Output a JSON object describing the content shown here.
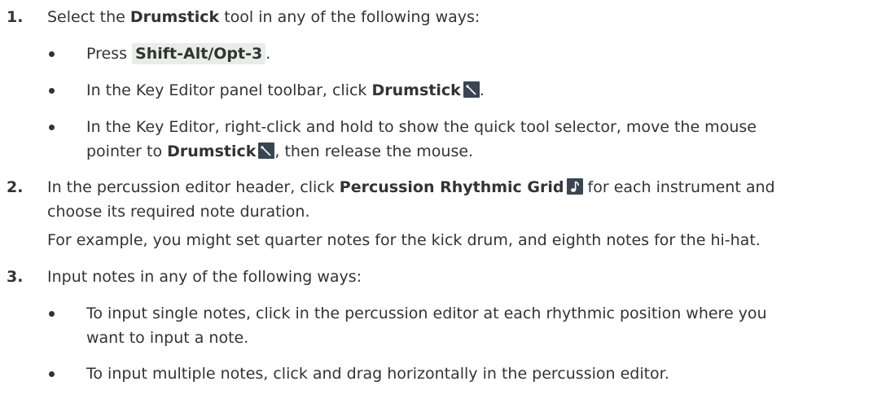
{
  "steps": [
    {
      "number": "1.",
      "intro": {
        "pre": "Select the ",
        "bold": "Drumstick",
        "post": " tool in any of the following ways:"
      },
      "bullets": {
        "b1": {
          "pre": "Press ",
          "shortcut": "Shift-Alt/Opt-3",
          "post": "."
        },
        "b2": {
          "pre": "In the Key Editor panel toolbar, click ",
          "bold": "Drumstick",
          "post": "."
        },
        "b3": {
          "line1": "In the Key Editor, right-click and hold to show the quick tool selector, move the mouse",
          "pre": "pointer to ",
          "bold": "Drumstick",
          "post": ", then release the mouse."
        }
      }
    },
    {
      "number": "2.",
      "pre": "In the percussion editor header, click ",
      "bold": "Percussion Rhythmic Grid",
      "post": " for each instrument and",
      "line2": "choose its required note duration.",
      "example": "For example, you might set quarter notes for the kick drum, and eighth notes for the hi-hat."
    },
    {
      "number": "3.",
      "intro": "Input notes in any of the following ways:",
      "bullets": {
        "b1": {
          "line1": "To input single notes, click in the percussion editor at each rhythmic position where you",
          "line2": "want to input a note."
        },
        "b2": {
          "line1": "To input multiple notes, click and drag horizontally in the percussion editor."
        }
      }
    }
  ],
  "icons": {
    "drumstick": "drumstick-icon",
    "rhythmic_grid": "eighth-note-icon",
    "icon_bg": "#3a4552",
    "shortcut_bg": "#e9ede9"
  }
}
